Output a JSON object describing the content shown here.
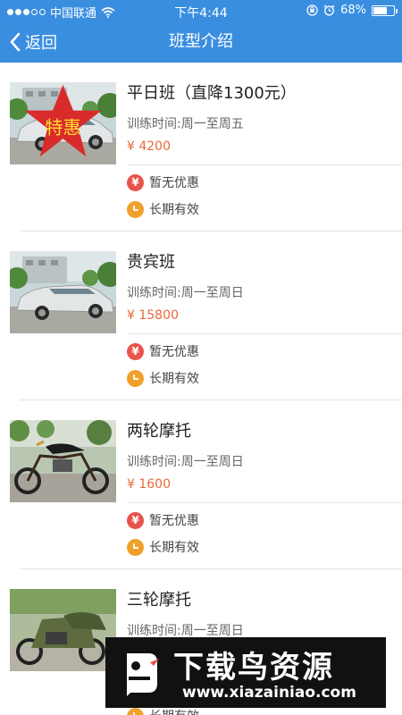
{
  "status_bar": {
    "carrier": "中国联通",
    "time": "下午4:44",
    "battery": "68%",
    "battery_level": 0.68,
    "signal_filled": 3,
    "signal_total": 5
  },
  "nav": {
    "back_label": "返回",
    "title": "班型介绍"
  },
  "courses": [
    {
      "name": "平日班（直降1300元）",
      "time": "训练时间:周一至周五",
      "price": "¥ 4200",
      "discount_icon": "¥",
      "discount": "暂无优惠",
      "validity": "长期有效",
      "badge": "特惠",
      "image": "white-sedan"
    },
    {
      "name": "贵宾班",
      "time": "训练时间:周一至周日",
      "price": "¥ 15800",
      "discount_icon": "¥",
      "discount": "暂无优惠",
      "validity": "长期有效",
      "image": "white-sedan"
    },
    {
      "name": "两轮摩托",
      "time": "训练时间:周一至周日",
      "price": "¥ 1600",
      "discount_icon": "¥",
      "discount": "暂无优惠",
      "validity": "长期有效",
      "image": "motorcycle"
    },
    {
      "name": "三轮摩托",
      "time": "训练时间:周一至周日",
      "price": "",
      "discount_icon": "¥",
      "discount": "",
      "validity": "长期有效",
      "image": "sidecar-motorcycle"
    }
  ],
  "watermark": {
    "title": "下载鸟资源",
    "url": "www.xiazainiao.com"
  },
  "colors": {
    "primary": "#3a8ee0",
    "price": "#e8693b",
    "discount_icon": "#e8534a",
    "validity_icon": "#f0a12c"
  }
}
